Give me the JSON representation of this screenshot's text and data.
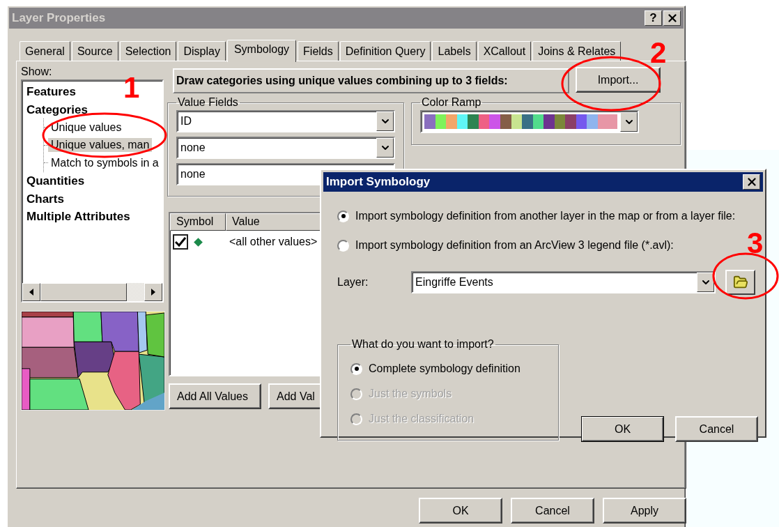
{
  "window": {
    "title": "Layer Properties",
    "help": "?"
  },
  "tabs": [
    {
      "label": "General",
      "selected": false
    },
    {
      "label": "Source",
      "selected": false
    },
    {
      "label": "Selection",
      "selected": false
    },
    {
      "label": "Display",
      "selected": false
    },
    {
      "label": "Symbology",
      "selected": true
    },
    {
      "label": "Fields",
      "selected": false
    },
    {
      "label": "Definition Query",
      "selected": false
    },
    {
      "label": "Labels",
      "selected": false
    },
    {
      "label": "XCallout",
      "selected": false
    },
    {
      "label": "Joins & Relates",
      "selected": false
    }
  ],
  "show_label": "Show:",
  "tree": [
    {
      "label": "Features",
      "selected": false
    },
    {
      "label": "Categories",
      "selected": false,
      "children": [
        {
          "label": "Unique values",
          "selected": false
        },
        {
          "label": "Unique values, man",
          "selected": true
        },
        {
          "label": "Match to symbols in a",
          "selected": false
        }
      ]
    },
    {
      "label": "Quantities",
      "selected": false
    },
    {
      "label": "Charts",
      "selected": false
    },
    {
      "label": "Multiple Attributes",
      "selected": false
    }
  ],
  "header": "Draw categories using unique values combining up to 3 fields:",
  "import_button": "Import...",
  "value_fields": {
    "title": "Value Fields",
    "fields": [
      "ID",
      "none",
      "none"
    ]
  },
  "color_ramp": {
    "title": "Color Ramp",
    "colors": [
      {
        "color": "#8a6fbf"
      },
      {
        "color": "#7ff25a"
      },
      {
        "color": "#f2a66a"
      },
      {
        "color": "#5ff6f6"
      },
      {
        "color": "#2e8452"
      },
      {
        "color": "#ee5f84"
      },
      {
        "color": "#cc55e8"
      },
      {
        "color": "#855e47"
      },
      {
        "color": "#c8e490"
      },
      {
        "color": "#3a7186"
      },
      {
        "color": "#52dc8c"
      },
      {
        "color": "#6e3390"
      },
      {
        "color": "#7b873a"
      },
      {
        "color": "#8b3f67"
      },
      {
        "color": "#7559ee"
      },
      {
        "color": "#8fb4ee"
      },
      {
        "color": "#e796a6"
      }
    ]
  },
  "symbol_list": {
    "columns": [
      "Symbol",
      "Value"
    ],
    "rows": [
      {
        "checked": true,
        "color": "#1b8a4a",
        "value": "<all other values>"
      }
    ]
  },
  "list_buttons": [
    "Add All Values",
    "Add Val"
  ],
  "buttons": [
    "OK",
    "Cancel",
    "Apply"
  ],
  "dialog": {
    "title": "Import Symbology",
    "sources": [
      {
        "label": "Import symbology definition from another layer in the map or from a layer file:",
        "selected": true
      },
      {
        "label": "Import symbology definition from an ArcView 3 legend file (*.avl):",
        "selected": false
      }
    ],
    "layer_label": "Layer:",
    "layer_value": "Eingriffe Events",
    "group_title": "What do you want to import?",
    "import_options": [
      {
        "label": "Complete symbology definition",
        "selected": true,
        "disabled": false
      },
      {
        "label": "Just the symbols",
        "selected": false,
        "disabled": true
      },
      {
        "label": "Just the classification",
        "selected": false,
        "disabled": true
      }
    ],
    "buttons": [
      {
        "label": "OK",
        "default": true
      },
      {
        "label": "Cancel",
        "default": false
      }
    ]
  },
  "annotations": [
    {
      "label": "1"
    },
    {
      "label": "2"
    },
    {
      "label": "3"
    }
  ]
}
